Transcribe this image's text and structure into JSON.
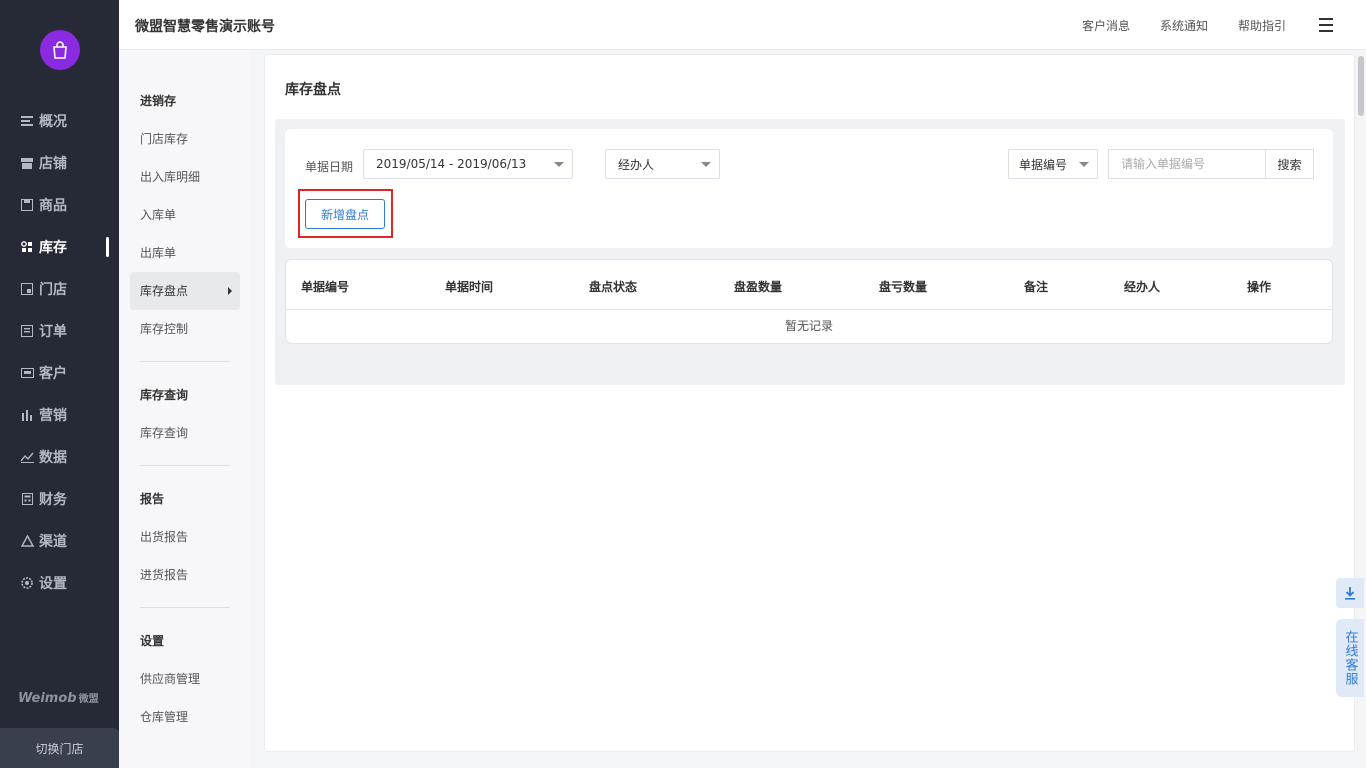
{
  "header": {
    "account": "微盟智慧零售演示账号",
    "links": [
      "客户消息",
      "系统通知",
      "帮助指引"
    ]
  },
  "nav": {
    "items": [
      {
        "label": "概况",
        "icon": "list-icon"
      },
      {
        "label": "店铺",
        "icon": "store-icon"
      },
      {
        "label": "商品",
        "icon": "product-icon"
      },
      {
        "label": "库存",
        "icon": "grid-icon",
        "active": true
      },
      {
        "label": "门店",
        "icon": "shop-icon"
      },
      {
        "label": "订单",
        "icon": "order-icon"
      },
      {
        "label": "客户",
        "icon": "vip-icon"
      },
      {
        "label": "营销",
        "icon": "bar-icon"
      },
      {
        "label": "数据",
        "icon": "chart-icon"
      },
      {
        "label": "财务",
        "icon": "calculator-icon"
      },
      {
        "label": "渠道",
        "icon": "recycle-icon"
      },
      {
        "label": "设置",
        "icon": "gear-icon"
      }
    ],
    "brand": "Weimob",
    "brand_cn": "微盟",
    "switch_store": "切换门店"
  },
  "subnav": {
    "groups": [
      {
        "title": "进销存",
        "items": [
          "门店库存",
          "出入库明细",
          "入库单",
          "出库单",
          "库存盘点",
          "库存控制"
        ]
      },
      {
        "title": "库存查询",
        "items": [
          "库存查询"
        ]
      },
      {
        "title": "报告",
        "items": [
          "出货报告",
          "进货报告"
        ]
      },
      {
        "title": "设置",
        "items": [
          "供应商管理",
          "仓库管理"
        ]
      }
    ]
  },
  "page": {
    "title": "库存盘点",
    "date_label": "单据日期",
    "date_range": "2019/05/14 - 2019/06/13",
    "operator_select": "经办人",
    "number_select": "单据编号",
    "search_placeholder": "请输入单据编号",
    "search_button": "搜索",
    "add_button": "新增盘点",
    "columns": [
      "单据编号",
      "单据时间",
      "盘点状态",
      "盘盈数量",
      "盘亏数量",
      "备注",
      "经办人",
      "操作"
    ],
    "empty_text": "暂无记录"
  },
  "float": {
    "customer_service": "在线客服"
  },
  "colors": {
    "nav_bg": "#262a36",
    "accent": "#2f7ad8",
    "highlight": "#e02727",
    "logo": "#8a2be2"
  }
}
